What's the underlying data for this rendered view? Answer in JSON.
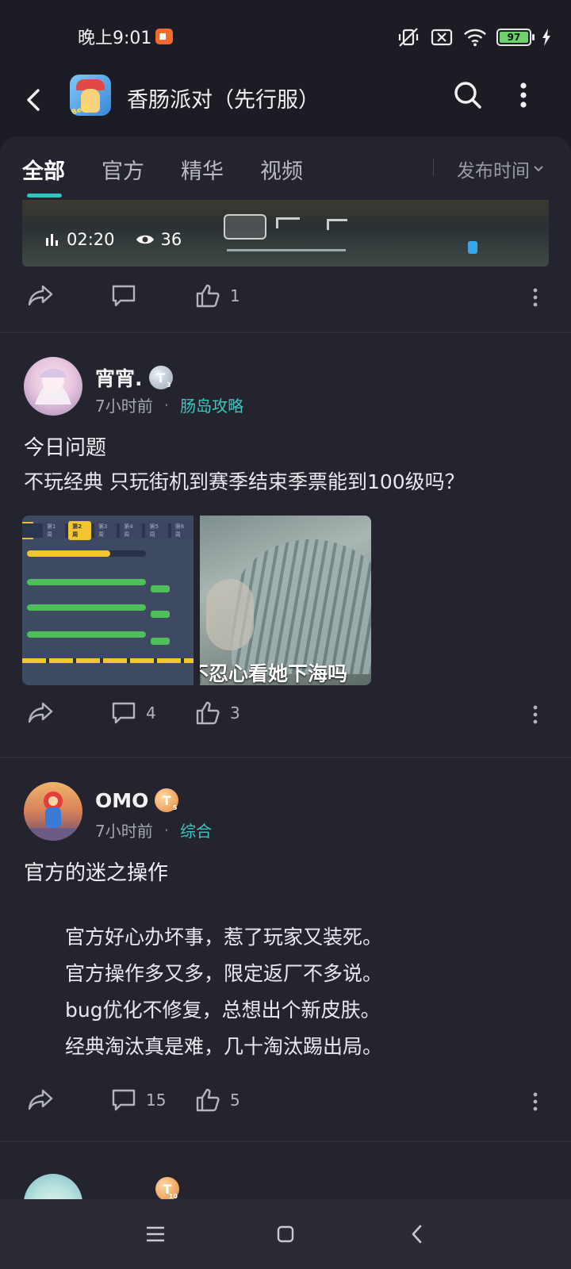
{
  "status_bar": {
    "time": "晚上9:01",
    "battery": "97"
  },
  "header": {
    "title": "香肠派对（先行服）",
    "app_icon_label": "Beta"
  },
  "tabs": [
    {
      "label": "全部",
      "active": true
    },
    {
      "label": "官方",
      "active": false
    },
    {
      "label": "精华",
      "active": false
    },
    {
      "label": "视频",
      "active": false
    }
  ],
  "sort": {
    "label": "发布时间"
  },
  "video_card": {
    "duration": "02:20",
    "views": "36",
    "likes": "1"
  },
  "posts": [
    {
      "username": "宵宵.",
      "badge": "T",
      "time": "7小时前",
      "topic": "肠岛攻略",
      "title": "今日问题",
      "body": [
        "不玩经典  只玩街机到赛季结束季票能到100级吗？"
      ],
      "image_caption": "不忍心看她下海吗",
      "comments": "4",
      "likes": "3"
    },
    {
      "username": "OMO",
      "badge": "T",
      "time": "7小时前",
      "topic": "综合",
      "title": "官方的迷之操作",
      "body": [
        "官方好心办坏事，惹了玩家又装死。",
        "官方操作多又多，限定返厂不多说。",
        " bug优化不修复，总想出个新皮肤。",
        "经典淘汰真是难，几十淘汰踢出局。"
      ],
      "comments": "15",
      "likes": "5"
    },
    {
      "badge": "T"
    }
  ],
  "screenshot_ui": {
    "weeks": [
      "第1周",
      "第2周",
      "第3周",
      "第4周",
      "第5周",
      "第6周"
    ]
  }
}
